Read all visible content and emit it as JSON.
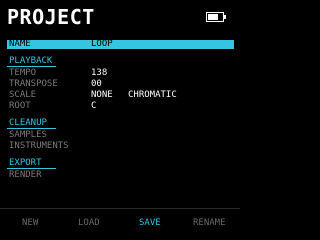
{
  "header": {
    "title": "PROJECT",
    "battery_icon": "battery-icon"
  },
  "name_row": {
    "label": "NAME",
    "value": "LOOP"
  },
  "playback": {
    "heading": "PLAYBACK",
    "tempo": {
      "label": "TEMPO",
      "value": "138"
    },
    "transpose": {
      "label": "TRANSPOSE",
      "value": "00"
    },
    "scale": {
      "label": "SCALE",
      "value": "NONE",
      "value2": "CHROMATIC"
    },
    "root": {
      "label": "ROOT",
      "value": "C"
    }
  },
  "cleanup": {
    "heading": "CLEANUP",
    "samples": "SAMPLES",
    "instruments": "INSTRUMENTS"
  },
  "export": {
    "heading": "EXPORT",
    "render": "RENDER"
  },
  "footer": {
    "new": "NEW",
    "load": "LOAD",
    "save": "SAVE",
    "rename": "RENAME"
  },
  "colors": {
    "accent": "#36c4e3",
    "label": "#7b7b7b",
    "value": "#ffffff",
    "background": "#000000"
  }
}
